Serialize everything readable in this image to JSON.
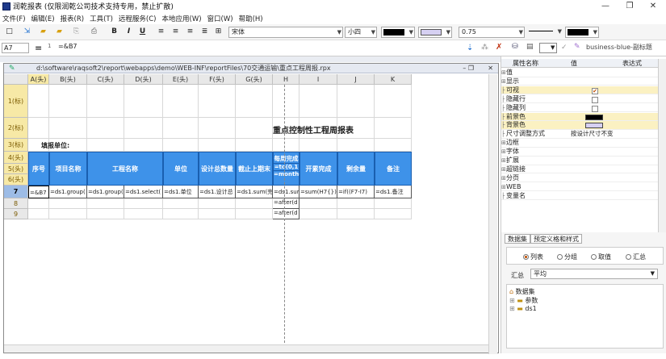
{
  "window": {
    "title": "润乾报表 (仅限润乾公司技术支持专用，禁止扩散)",
    "controls": [
      "—",
      "❐",
      "✕"
    ]
  },
  "menu": [
    "文件(F)",
    "编辑(E)",
    "报表(R)",
    "工具(T)",
    "远程服务(C)",
    "本地应用(W)",
    "窗口(W)",
    "帮助(H)"
  ],
  "toolbar": {
    "font_name": "宋体",
    "font_size": "小四",
    "border_width": "0.75",
    "style_name": "business-blue-副标题"
  },
  "formula_bar": {
    "cell_ref": "A7",
    "equals": "=",
    "row_marker": "1",
    "value": "=&B7"
  },
  "document": {
    "path": "d:\\software\\raqsoft2\\report\\webapps\\demo\\WEB-INF\\reportFiles\\70交通运输\\重点工程周报.rpx",
    "column_headers": [
      "A(头)",
      "B(头)",
      "C(头)",
      "D(头)",
      "E(头)",
      "F(头)",
      "G(头)",
      "H",
      "I",
      "J",
      "K"
    ],
    "row_headers": [
      "1(标)",
      "2(标)",
      "3(标)",
      "4(头)",
      "5(头)",
      "6(头)",
      "7",
      "8",
      "9"
    ],
    "report_title": "重点控制性工程周报表",
    "fill_unit": "填报单位:",
    "headers": [
      "序号",
      "项目名称",
      "工程名称",
      "单位",
      "设计总数量",
      "截止上期末",
      "每周完成",
      "开累完成",
      "剩余量",
      "备注"
    ],
    "weekly_sub": [
      "=to(0,1",
      "=month("
    ],
    "row7": [
      "=&B7",
      "=ds1.group(",
      "=ds1.group(",
      "=ds1.select(",
      "=ds1.单位",
      "=ds1.设计总",
      "=ds1.sum(完",
      "=ds1.sum",
      "=sum(H7{})",
      "=if((F7-I7)",
      "=ds1.备注"
    ],
    "row8": "=after(d",
    "row9": "=after(d"
  },
  "properties": {
    "headers": [
      "属性名称",
      "值",
      "表达式"
    ],
    "items": [
      {
        "name": "值",
        "group": true
      },
      {
        "name": "显示",
        "group": true
      },
      {
        "name": "可视",
        "value": "checked"
      },
      {
        "name": "隐藏行",
        "value": "unchecked"
      },
      {
        "name": "隐藏列",
        "value": "unchecked"
      },
      {
        "name": "前景色",
        "value": "black"
      },
      {
        "name": "背景色",
        "value": "lavender"
      },
      {
        "name": "尺寸调整方式",
        "value": "按设计尺寸不变"
      },
      {
        "name": "边框",
        "group": true
      },
      {
        "name": "字体",
        "group": true
      },
      {
        "name": "扩展",
        "group": true
      },
      {
        "name": "超链接",
        "group": true
      },
      {
        "name": "分页",
        "group": true
      },
      {
        "name": "WEB",
        "group": true
      },
      {
        "name": "变量名",
        "group": false
      }
    ]
  },
  "bottom_panel": {
    "tabs": [
      "数据集",
      "预定义格和样式"
    ],
    "radios": [
      "列表",
      "分组",
      "取值",
      "汇总"
    ],
    "summary_label": "汇总",
    "summary_value": "平均",
    "tree": [
      "数据集",
      "参数",
      "ds1"
    ]
  },
  "colors": {
    "header_blue": "#3e92e9",
    "selected_row": "#9dbce6",
    "row_marker_yellow": "#f7e9a6"
  }
}
